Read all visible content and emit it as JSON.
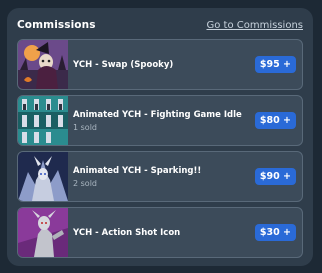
{
  "header": {
    "title": "Commissions",
    "link_label": "Go to Commissions"
  },
  "items": [
    {
      "name": "YCH - Swap (Spooky)",
      "sold": "",
      "price": "$95 +",
      "thumb_icon": "spooky-witch-artwork"
    },
    {
      "name": "Animated YCH - Fighting Game Idle",
      "sold": "1 sold",
      "price": "$80 +",
      "thumb_icon": "fighting-game-sprite-sheet"
    },
    {
      "name": "Animated YCH - Sparking!!",
      "sold": "2 sold",
      "price": "$90 +",
      "thumb_icon": "sparking-character-artwork"
    },
    {
      "name": "YCH - Action Shot Icon",
      "sold": "",
      "price": "$30 +",
      "thumb_icon": "action-shot-character-artwork"
    }
  ],
  "colors": {
    "page_bg": "#1d2935",
    "card_bg": "#2f3d4b",
    "item_bg": "#3c4b5a",
    "price_bg": "#2a6ad7"
  }
}
